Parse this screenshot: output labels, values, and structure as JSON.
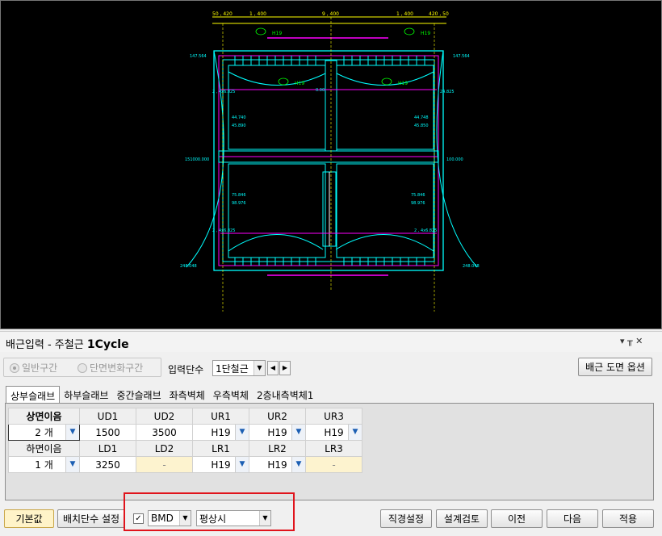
{
  "panel": {
    "title_prefix": "배근입력 - 주철근",
    "title_cycle": "1Cycle",
    "ctrl_pin": "▾ ╥ ✕"
  },
  "section": {
    "option_general": "일반구간",
    "option_change": "단면변화구간",
    "input_stage_label": "입력단수",
    "input_stage_value": "1단철근",
    "drawing_option_button": "배근 도면 옵션"
  },
  "tabs": [
    "상부슬래브",
    "하부슬래브",
    "중간슬래브",
    "좌측벽체",
    "우측벽체",
    "2층내측벽체1"
  ],
  "table": {
    "top_header": [
      "상면이음",
      "UD1",
      "UD2",
      "UR1",
      "UR2",
      "UR3"
    ],
    "top_values": [
      "2 개",
      "1500",
      "3500",
      "H19",
      "H19",
      "H19"
    ],
    "bottom_header": [
      "하면이음",
      "LD1",
      "LD2",
      "LR1",
      "LR2",
      "LR3"
    ],
    "bottom_values": [
      "1 개",
      "3250",
      "-",
      "H19",
      "H19",
      "-"
    ]
  },
  "footer": {
    "default_button": "기본값",
    "stage_setting_button": "배치단수 설정",
    "bmd_value": "BMD",
    "condition_value": "평상시",
    "diameter_button": "직경설정",
    "design_check_button": "설계검토",
    "prev_button": "이전",
    "next_button": "다음",
    "apply_button": "적용"
  },
  "cad_labels": {
    "dim_top": [
      "50 , 420",
      "1 , 400",
      "9 , 400",
      "1 , 400",
      "420 , 50"
    ],
    "h19": "H19",
    "left_dims": [
      "147.564",
      "2 , 4x6.825",
      "44.740",
      "45.890",
      "151000.000",
      "75.846",
      "98.976",
      "2 , 4x6.825",
      "248.048"
    ],
    "right_dims": [
      "147.564",
      "24.825",
      "44.748",
      "45.850",
      "100.000",
      "75.846",
      "98.976",
      "2 , 4x6.825",
      "248.048"
    ],
    "center_dim": "0.00"
  },
  "colors": {
    "cad_bg": "#000000",
    "cad_cyan": "#00ffff",
    "cad_magenta": "#ff00ff",
    "cad_yellow": "#ffff00",
    "cad_green": "#00ff00",
    "highlight_red": "#e0141c"
  }
}
